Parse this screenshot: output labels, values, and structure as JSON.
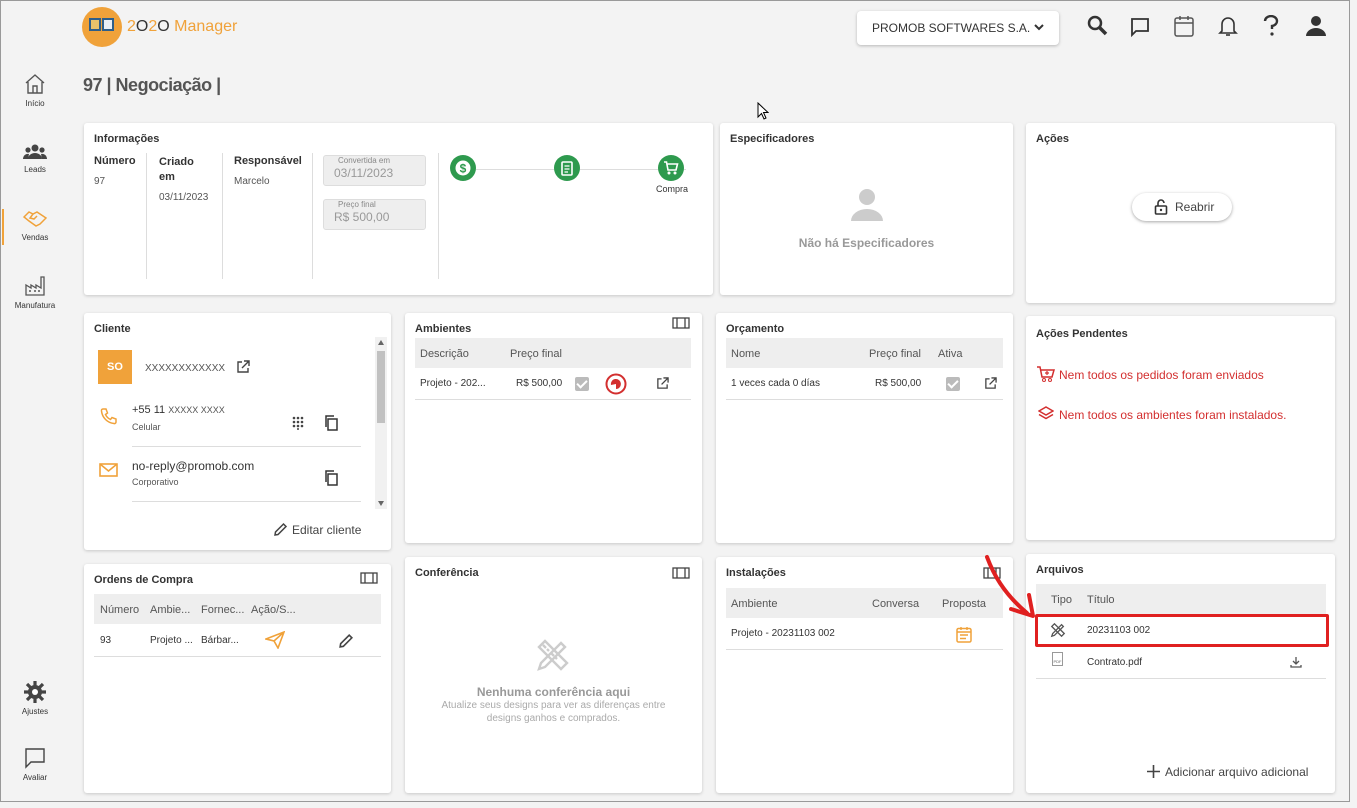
{
  "brand": {
    "prefix": "2",
    "o1": "O",
    "mid": "2",
    "o2": "O",
    "name": " Manager"
  },
  "company": {
    "label": "PROMOB SOFTWARES S.A."
  },
  "sidebar": {
    "items": [
      {
        "label": "Início",
        "icon": "home-icon"
      },
      {
        "label": "Leads",
        "icon": "group-icon"
      },
      {
        "label": "Vendas",
        "icon": "handshake-icon"
      },
      {
        "label": "Manufatura",
        "icon": "factory-icon"
      },
      {
        "label": "Ajustes",
        "icon": "gear-icon"
      },
      {
        "label": "Avaliar",
        "icon": "chat-icon"
      }
    ]
  },
  "page": {
    "title": "97 | Negociação |"
  },
  "info": {
    "title": "Informações",
    "numero_label": "Número",
    "numero": "97",
    "criado_label": "Criado em",
    "criado": "03/11/2023",
    "resp_label": "Responsável",
    "resp": "Marcelo",
    "convertida_label": "Convertida em",
    "convertida": "03/11/2023",
    "preco_label": "Preço final",
    "preco": "R$ 500,00",
    "step_compra": "Compra"
  },
  "especificadores": {
    "title": "Especificadores",
    "empty": "Não há Especificadores"
  },
  "acoes": {
    "title": "Ações",
    "reabrir": "Reabrir"
  },
  "cliente": {
    "title": "Cliente",
    "avatar": "SO",
    "name": "XXXXXXXXXXXX",
    "phone": "+55 11",
    "phone_mask": "XXXXX XXXX",
    "phone_type": "Celular",
    "email": "no-reply@promob.com",
    "email_type": "Corporativo",
    "edit": "Editar cliente"
  },
  "ambientes": {
    "title": "Ambientes",
    "headers": [
      "Descrição",
      "Preço final"
    ],
    "rows": [
      {
        "descricao": "Projeto - 202...",
        "preco": "R$ 500,00"
      }
    ]
  },
  "orcamento": {
    "title": "Orçamento",
    "headers": [
      "Nome",
      "Preço final",
      "Ativa"
    ],
    "rows": [
      {
        "nome": "1 veces cada 0 días",
        "preco": "R$ 500,00"
      }
    ]
  },
  "pendentes": {
    "title": "Ações Pendentes",
    "items": [
      "Nem todos os pedidos foram enviados",
      "Nem todos os ambientes foram instalados."
    ]
  },
  "ordens": {
    "title": "Ordens de Compra",
    "headers": [
      "Número",
      "Ambie...",
      "Fornec...",
      "Ação/S..."
    ],
    "rows": [
      {
        "numero": "93",
        "ambiente": "Projeto ...",
        "fornecedor": "Bárbar..."
      }
    ]
  },
  "conferencia": {
    "title": "Conferência",
    "empty_title": "Nenhuma conferência aqui",
    "empty_line1": "Atualize seus designs para ver as diferenças entre",
    "empty_line2": "designs ganhos e comprados."
  },
  "instalacoes": {
    "title": "Instalações",
    "headers": [
      "Ambiente",
      "Conversa",
      "Proposta"
    ],
    "rows": [
      {
        "ambiente": "Projeto - 20231103 002"
      }
    ]
  },
  "arquivos": {
    "title": "Arquivos",
    "headers": [
      "Tipo",
      "Título"
    ],
    "rows": [
      {
        "titulo": "20231103 002"
      },
      {
        "titulo": "Contrato.pdf",
        "type_label": "PDF"
      }
    ],
    "add": "Adicionar arquivo adicional"
  },
  "colors": {
    "accent": "#f0a23a",
    "green": "#2e9a4e",
    "red": "#d32f2f"
  }
}
